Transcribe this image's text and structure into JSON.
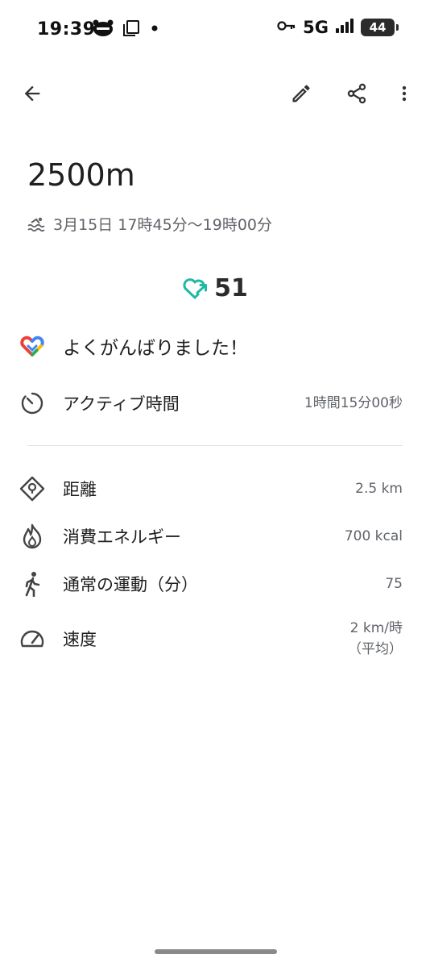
{
  "status_bar": {
    "time": "19:39",
    "network": "5G",
    "battery": "44"
  },
  "activity": {
    "title": "2500m",
    "time_range": "3月15日 17時45分〜19時00分",
    "heart_points": "51",
    "message": "よくがんばりました！"
  },
  "active_time": {
    "label": "アクティブ時間",
    "value": "1時間15分00秒"
  },
  "stats": {
    "distance": {
      "label": "距離",
      "value": "2.5 km"
    },
    "calories": {
      "label": "消費エネルギー",
      "value": "700 kcal"
    },
    "move_minutes": {
      "label": "通常の運動（分）",
      "value": "75"
    },
    "speed": {
      "label": "速度",
      "value_line1": "2 km/時",
      "value_line2": "（平均）"
    }
  },
  "icons": {
    "back": "arrow-back-icon",
    "edit": "pencil-icon",
    "share": "share-icon",
    "more": "more-vert-icon",
    "swim": "swimming-icon",
    "heart_points": "heart-points-icon",
    "google_fit": "google-fit-logo-icon",
    "timer": "timer-icon",
    "distance": "location-diamond-icon",
    "calories": "flame-icon",
    "move": "walking-person-icon",
    "speed": "speedometer-icon"
  },
  "colors": {
    "heart_teal": "#1fb9a6",
    "fit_blue": "#4285f4",
    "fit_red": "#ea4335",
    "fit_yellow": "#fbbc05",
    "fit_green": "#34a853"
  }
}
